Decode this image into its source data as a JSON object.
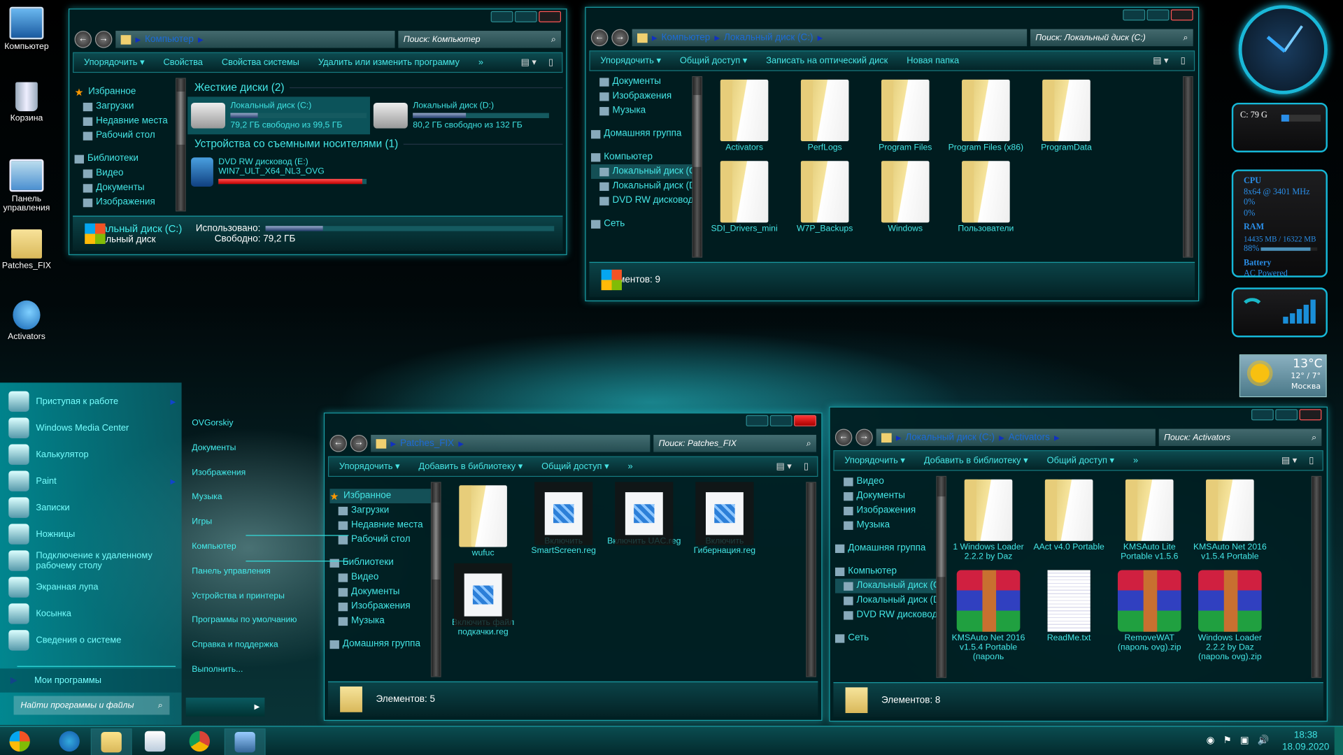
{
  "desktop_icons": [
    {
      "label": "Компьютер",
      "icon": "computer-icon",
      "cls": "ic-computer"
    },
    {
      "label": "Корзина",
      "icon": "recycle-bin-icon",
      "cls": "ic-trash"
    },
    {
      "label": "Панель управления",
      "icon": "control-panel-icon",
      "cls": "ic-cpanel"
    },
    {
      "label": "Patches_FIX",
      "icon": "folder-icon",
      "cls": "ic-folder"
    },
    {
      "label": "Activators",
      "icon": "activators-icon",
      "cls": "ic-activ"
    }
  ],
  "windows": [
    {
      "kind": "computer",
      "active": false,
      "crumbs": [
        "Компьютер"
      ],
      "search": "Поиск: Компьютер",
      "toolbar": [
        "Упорядочить ▾",
        "Свойства",
        "Свойства системы",
        "Удалить или изменить программу",
        "»"
      ],
      "nav": [
        {
          "label": "Избранное",
          "t": "hdr",
          "icon": "star"
        },
        {
          "label": "Загрузки",
          "t": "sub"
        },
        {
          "label": "Недавние места",
          "t": "sub"
        },
        {
          "label": "Рабочий стол",
          "t": "sub"
        },
        {
          "label": "Библиотеки",
          "t": "hdr"
        },
        {
          "label": "Видео",
          "t": "sub"
        },
        {
          "label": "Документы",
          "t": "sub"
        },
        {
          "label": "Изображения",
          "t": "sub"
        }
      ],
      "groups": [
        {
          "title": "Жесткие диски (2)",
          "drives": [
            {
              "name": "Локальный диск (C:)",
              "info": "79,2 ГБ свободно из 99,5 ГБ",
              "used_percent": 20,
              "selected": true,
              "icon": "windows-drive-icon"
            },
            {
              "name": "Локальный диск (D:)",
              "info": "80,2 ГБ свободно из 132 ГБ",
              "used_percent": 39,
              "selected": false,
              "icon": "hard-drive-icon"
            }
          ]
        },
        {
          "title": "Устройства со съемными носителями (1)",
          "drives": [
            {
              "name": "DVD RW дисковод (E:)",
              "info": "WIN7_ULT_X64_NL3_OVG",
              "used_percent": 97,
              "selected": false,
              "full": true,
              "icon": "dvd-drive-icon"
            }
          ]
        }
      ],
      "details": {
        "name": "Локальный диск (C:)",
        "type": "Локальный диск",
        "used_label": "Использовано:",
        "used_percent": 20,
        "free": "Свободно: 79,2 ГБ"
      }
    },
    {
      "kind": "folder",
      "active": false,
      "crumbs": [
        "Компьютер",
        "Локальный диск (C:)"
      ],
      "search": "Поиск: Локальный диск (C:)",
      "toolbar": [
        "Упорядочить ▾",
        "Общий доступ ▾",
        "Записать на оптический диск",
        "Новая папка"
      ],
      "nav": [
        {
          "label": "Документы",
          "t": "sub"
        },
        {
          "label": "Изображения",
          "t": "sub"
        },
        {
          "label": "Музыка",
          "t": "sub"
        },
        {
          "label": "Домашняя группа",
          "t": "hdr"
        },
        {
          "label": "Компьютер",
          "t": "hdr"
        },
        {
          "label": "Локальный диск (C:)",
          "t": "sub",
          "sel": true
        },
        {
          "label": "Локальный диск (D:)",
          "t": "sub"
        },
        {
          "label": "DVD RW дисковод",
          "t": "sub"
        },
        {
          "label": "Сеть",
          "t": "hdr"
        }
      ],
      "items": [
        {
          "label": "Activators",
          "type": "folder"
        },
        {
          "label": "PerfLogs",
          "type": "folder"
        },
        {
          "label": "Program Files",
          "type": "folder"
        },
        {
          "label": "Program Files (x86)",
          "type": "folder"
        },
        {
          "label": "ProgramData",
          "type": "folder"
        },
        {
          "label": "SDI_Drivers_mini",
          "type": "folder"
        },
        {
          "label": "W7P_Backups",
          "type": "folder"
        },
        {
          "label": "Windows",
          "type": "folder"
        },
        {
          "label": "Пользователи",
          "type": "folder"
        }
      ],
      "status": "Элементов: 9",
      "status_icon": "win"
    },
    {
      "kind": "folder",
      "active": true,
      "crumbs": [
        "Patches_FIX"
      ],
      "search": "Поиск: Patches_FIX",
      "toolbar": [
        "Упорядочить ▾",
        "Добавить в библиотеку ▾",
        "Общий доступ ▾",
        "»"
      ],
      "nav": [
        {
          "label": "Избранное",
          "t": "hdr",
          "icon": "star",
          "sel": true
        },
        {
          "label": "Загрузки",
          "t": "sub"
        },
        {
          "label": "Недавние места",
          "t": "sub"
        },
        {
          "label": "Рабочий стол",
          "t": "sub"
        },
        {
          "label": "Библиотеки",
          "t": "hdr"
        },
        {
          "label": "Видео",
          "t": "sub"
        },
        {
          "label": "Документы",
          "t": "sub"
        },
        {
          "label": "Изображения",
          "t": "sub"
        },
        {
          "label": "Музыка",
          "t": "sub"
        },
        {
          "label": "Домашняя группа",
          "t": "hdr"
        }
      ],
      "items": [
        {
          "label": "wufuc",
          "type": "folder"
        },
        {
          "label": "Включить SmartScreen.reg",
          "type": "reg"
        },
        {
          "label": "Включить UAC.reg",
          "type": "reg"
        },
        {
          "label": "Включить Гибернация.reg",
          "type": "reg"
        },
        {
          "label": "Включить файл подкачки.reg",
          "type": "reg"
        }
      ],
      "status": "Элементов: 5",
      "status_icon": "folder"
    },
    {
      "kind": "folder",
      "active": false,
      "crumbs": [
        "Локальный диск (C:)",
        "Activators"
      ],
      "search": "Поиск: Activators",
      "toolbar": [
        "Упорядочить ▾",
        "Добавить в библиотеку ▾",
        "Общий доступ ▾",
        "»"
      ],
      "nav": [
        {
          "label": "Видео",
          "t": "sub"
        },
        {
          "label": "Документы",
          "t": "sub"
        },
        {
          "label": "Изображения",
          "t": "sub"
        },
        {
          "label": "Музыка",
          "t": "sub"
        },
        {
          "label": "Домашняя группа",
          "t": "hdr"
        },
        {
          "label": "Компьютер",
          "t": "hdr"
        },
        {
          "label": "Локальный диск (C:)",
          "t": "sub",
          "sel": true
        },
        {
          "label": "Локальный диск (D:)",
          "t": "sub"
        },
        {
          "label": "DVD RW дисковод",
          "t": "sub"
        },
        {
          "label": "Сеть",
          "t": "hdr"
        }
      ],
      "items": [
        {
          "label": "1 Windows Loader 2.2.2 by Daz",
          "type": "folder"
        },
        {
          "label": "AAct v4.0 Portable",
          "type": "folder"
        },
        {
          "label": "KMSAuto Lite Portable v1.5.6",
          "type": "folder"
        },
        {
          "label": "KMSAuto Net 2016 v1.5.4 Portable",
          "type": "folder"
        },
        {
          "label": "KMSAuto Net 2016 v1.5.4 Portable (пароль",
          "type": "zip"
        },
        {
          "label": "ReadMe.txt",
          "type": "txt"
        },
        {
          "label": "RemoveWAT (пароль ovg).zip",
          "type": "zip"
        },
        {
          "label": "Windows Loader 2.2.2 by Daz (пароль ovg).zip",
          "type": "zip"
        }
      ],
      "status": "Элементов: 8",
      "status_icon": "folder"
    }
  ],
  "start_menu": {
    "left": [
      {
        "label": "Приступая к работе",
        "sub": true
      },
      {
        "label": "Windows Media Center"
      },
      {
        "label": "Калькулятор"
      },
      {
        "label": "Paint",
        "sub": true
      },
      {
        "label": "Записки"
      },
      {
        "label": "Ножницы"
      },
      {
        "label": "Подключение к удаленному рабочему столу"
      },
      {
        "label": "Экранная лупа"
      },
      {
        "label": "Косынка"
      },
      {
        "label": "Сведения о системе"
      }
    ],
    "all_programs": "Мои программы",
    "search_placeholder": "Найти программы и файлы",
    "right": [
      "OVGorskiy",
      "Документы",
      "Изображения",
      "Музыка",
      "Игры",
      "Компьютер",
      "Панель управления",
      "Устройства и принтеры",
      "Программы по умолчанию",
      "Справка и поддержка",
      "Выполнить..."
    ]
  },
  "taskbar": {
    "apps": [
      "start-orb",
      "internet-explorer",
      "explorer",
      "media-player",
      "chrome",
      "photo-viewer"
    ],
    "time": "18:38",
    "date": "18.09.2020"
  },
  "gadgets": {
    "disk": {
      "label": "C: 79 G",
      "used_percent": 20
    },
    "cpu": {
      "title": "CPU",
      "spec": "8x64 @ 3401 MHz",
      "core1": "0%",
      "core2": "0%"
    },
    "ram": {
      "title": "RAM",
      "usage": "14435 MB / 16322 MB",
      "percent": "88%",
      "percent_value": 88
    },
    "battery": {
      "title": "Battery",
      "state": "AC Powered"
    },
    "weather": {
      "temp": "13°C",
      "range": "12° / 7°",
      "city": "Москва"
    }
  },
  "colors": {
    "accent": "#1ab8d8",
    "text": "#3fe3e3",
    "close": "#e01010"
  }
}
